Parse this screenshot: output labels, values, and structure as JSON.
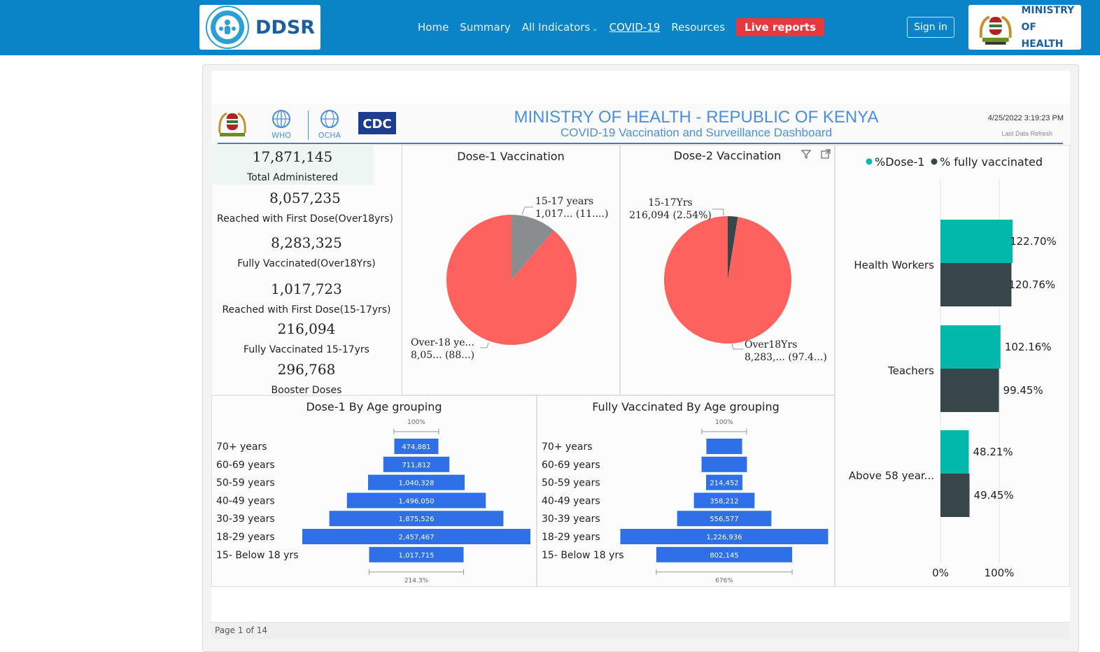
{
  "header": {
    "brand": "DDSR",
    "nav": [
      "Home",
      "Summary",
      "All Indicators",
      "COVID-19",
      "Resources"
    ],
    "live_reports": "Live reports",
    "sign_in": "Sign in",
    "ministry_line1": "MINISTRY",
    "ministry_line2": "OF HEALTH",
    "colors": {
      "bar": "#0a84c6",
      "live": "#e6383d"
    }
  },
  "dashboard": {
    "title": "MINISTRY OF HEALTH - REPUBLIC OF KENYA",
    "subtitle": "COVID-19 Vaccination and Surveillance Dashboard",
    "refresh_time": "4/25/2022 3:19:23 PM",
    "refresh_label": "Last Data Refresh",
    "logos": [
      "WHO",
      "OCHA",
      "CDC"
    ],
    "page": "Page 1 of 14"
  },
  "kpis": [
    {
      "value": "17,871,145",
      "label": "Total Administered"
    },
    {
      "value": "8,057,235",
      "label": "Reached with First Dose(Over18yrs)"
    },
    {
      "value": "8,283,325",
      "label": "Fully Vaccinated(Over18Yrs)"
    },
    {
      "value": "1,017,723",
      "label": "Reached with First Dose(15-17yrs)"
    },
    {
      "value": "216,094",
      "label": "Fully Vaccinated 15-17yrs"
    },
    {
      "value": "296,768",
      "label": "Booster Doses"
    }
  ],
  "chart_data": [
    {
      "type": "pie",
      "title": "Dose-1 Vaccination",
      "labels": [
        "15-17 years",
        "Over-18 ye..."
      ],
      "values": [
        1017723,
        8057235
      ],
      "label_texts": [
        [
          "15-17 years",
          "1,017... (11....)"
        ],
        [
          "Over-18 ye...",
          "8,05... (88...)"
        ]
      ],
      "colors": [
        "#8a8d8f",
        "#fd625e"
      ]
    },
    {
      "type": "pie",
      "title": "Dose-2 Vaccination",
      "labels": [
        "15-17Yrs",
        "Over18Yrs"
      ],
      "values": [
        216094,
        8283325
      ],
      "label_texts": [
        [
          "15-17Yrs",
          "216,094 (2.54%)"
        ],
        [
          "Over18Yrs",
          "8,283,... (97.4...)"
        ]
      ],
      "colors": [
        "#374649",
        "#fd625e"
      ]
    },
    {
      "type": "bar",
      "title": "Dose-1 By Age grouping",
      "categories": [
        "70+ years",
        "60-69 years",
        "50-59 years",
        "40-49 years",
        "30-39 years",
        "18-29 years",
        "15- Below 18 yrs"
      ],
      "values": [
        474881,
        711812,
        1040328,
        1496050,
        1875526,
        2457467,
        1017715
      ],
      "value_labels": [
        "474,881",
        "711,812",
        "1,040,328",
        "1,496,050",
        "1,875,526",
        "2,457,467",
        "1,017,715"
      ],
      "top_label": "100%",
      "bottom_label": "214.3%",
      "color": "#2f6fe8"
    },
    {
      "type": "bar",
      "title": "Fully Vaccinated By Age grouping",
      "categories": [
        "70+ years",
        "60-69 years",
        "50-59 years",
        "40-49 years",
        "30-39 years",
        "18-29 years",
        "15- Below 18 yrs"
      ],
      "values": [
        211000,
        268000,
        214452,
        358212,
        556577,
        1226936,
        802145
      ],
      "value_labels": [
        "",
        "",
        "214,452",
        "358,212",
        "556,577",
        "1,226,936",
        "802,145"
      ],
      "top_label": "100%",
      "bottom_label": "676%",
      "color": "#2f6fe8"
    },
    {
      "type": "bar",
      "orientation": "horizontal",
      "legend": [
        "%Dose-1",
        "% fully vaccinated"
      ],
      "categories": [
        "Health Workers",
        "Teachers",
        "Above 58 year..."
      ],
      "series": [
        {
          "name": "%Dose-1",
          "values": [
            122.7,
            102.16,
            48.21
          ],
          "labels": [
            "122.70%",
            "102.16%",
            "48.21%"
          ],
          "color": "#01b8aa"
        },
        {
          "name": "% fully vaccinated",
          "values": [
            120.76,
            99.45,
            49.45
          ],
          "labels": [
            "120.76%",
            "99.45%",
            "49.45%"
          ],
          "color": "#374649"
        }
      ],
      "x_ticks": [
        "0%",
        "100%"
      ]
    }
  ]
}
